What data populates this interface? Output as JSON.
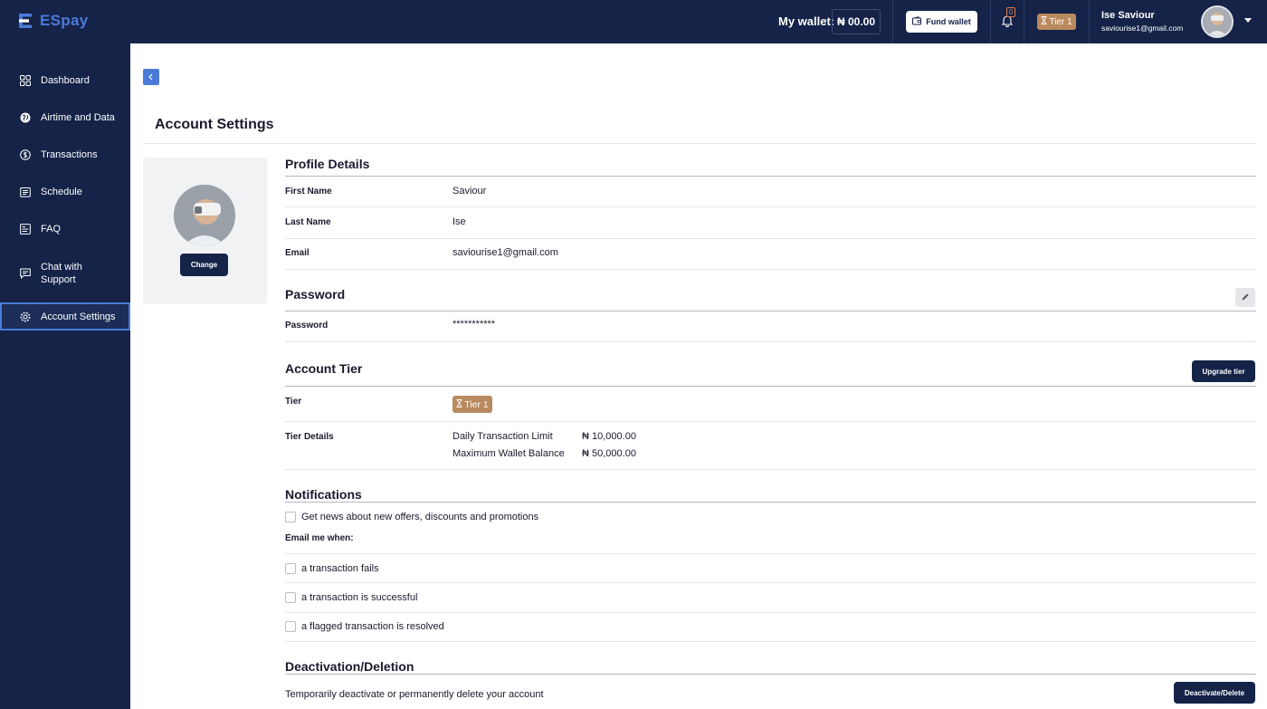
{
  "header": {
    "logo_text": "ESpay",
    "wallet_label": "My wallet:",
    "wallet_amount": "₦ 00.00",
    "fund_wallet_label": "Fund wallet",
    "notification_count": "0",
    "tier_badge": "Tier 1",
    "user_name": "Ise Saviour",
    "user_email": "saviourise1@gmail.com"
  },
  "sidebar": {
    "items": [
      {
        "label": "Dashboard",
        "icon": "grid-icon"
      },
      {
        "label": "Airtime and Data",
        "icon": "globe-icon"
      },
      {
        "label": "Transactions",
        "icon": "dollar-icon"
      },
      {
        "label": "Schedule",
        "icon": "calendar-icon"
      },
      {
        "label": "FAQ",
        "icon": "faq-icon"
      },
      {
        "label": "Chat with Support",
        "icon": "chat-icon"
      },
      {
        "label": "Account Settings",
        "icon": "gear-icon",
        "active": true
      }
    ]
  },
  "page": {
    "title": "Account Settings"
  },
  "profile_card": {
    "change_label": "Change"
  },
  "profile": {
    "title": "Profile Details",
    "first_name_label": "First Name",
    "first_name_value": "Saviour",
    "last_name_label": "Last Name",
    "last_name_value": "Ise",
    "email_label": "Email",
    "email_value": "saviourise1@gmail.com"
  },
  "password": {
    "title": "Password",
    "label": "Password",
    "value": "***********"
  },
  "tier": {
    "title": "Account Tier",
    "upgrade_label": "Upgrade tier",
    "tier_label": "Tier",
    "tier_value": "Tier 1",
    "details_label": "Tier Details",
    "daily_limit_label": "Daily Transaction Limit",
    "daily_limit_value": "₦ 10,000.00",
    "max_balance_label": "Maximum Wallet Balance",
    "max_balance_value": "₦ 50,000.00"
  },
  "notifications": {
    "title": "Notifications",
    "news_label": "Get news about new offers, discounts and promotions",
    "email_me_label": "Email me when:",
    "options": [
      {
        "label": "a transaction fails"
      },
      {
        "label": "a transaction is successful"
      },
      {
        "label": "a flagged transaction is resolved"
      }
    ]
  },
  "deactivation": {
    "title": "Deactivation/Deletion",
    "description": "Temporarily deactivate or permanently delete your account",
    "button_label": "Deactivate/Delete"
  },
  "colors": {
    "navy": "#152348",
    "accent_blue": "#4a7bd8",
    "tier_brown": "#b98a5e",
    "notification_orange": "#e07a4a"
  }
}
